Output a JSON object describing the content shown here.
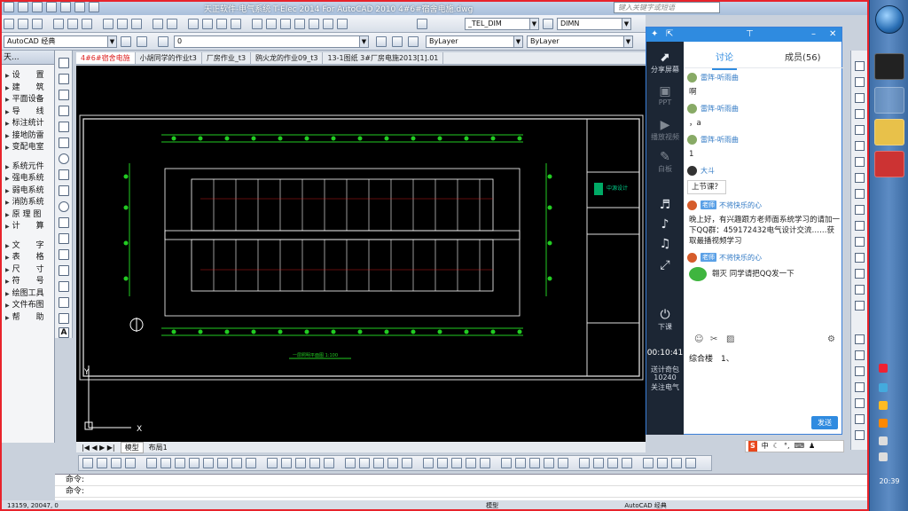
{
  "window": {
    "title": "天正软件-电气系统 T-Elec 2014  For AutoCAD 2010    4#6#宿舍电施.dwg",
    "search_placeholder": "键入关键字或短语"
  },
  "toolbar": {
    "workspace": "AutoCAD 经典",
    "layer_value": "0",
    "text_style": "_TEL_DIM",
    "dim_style": "DIMN",
    "table_style": "Standard",
    "mleader_style": "Standard",
    "color": "ByLayer",
    "linetype": "ByLayer",
    "lineweight": "ByLayer"
  },
  "left_panel": {
    "header": "天...",
    "items": [
      {
        "label": "设　　置"
      },
      {
        "label": "建　　筑"
      },
      {
        "label": "平面设备"
      },
      {
        "label": "导　　线"
      },
      {
        "label": "标注统计"
      },
      {
        "label": "接地防雷"
      },
      {
        "label": "变配电室"
      },
      {
        "label": "系统元件"
      },
      {
        "label": "强电系统"
      },
      {
        "label": "弱电系统"
      },
      {
        "label": "消防系统"
      },
      {
        "label": "原 理 图"
      },
      {
        "label": "计　　算"
      },
      {
        "label": "文　　字"
      },
      {
        "label": "表　　格"
      },
      {
        "label": "尺　　寸"
      },
      {
        "label": "符　　号"
      },
      {
        "label": "绘图工具"
      },
      {
        "label": "文件布图"
      },
      {
        "label": "帮　　助"
      }
    ]
  },
  "doc_tabs": [
    {
      "label": "4#6#宿舍电施",
      "active": true
    },
    {
      "label": "小胡同学的作业t3",
      "active": false
    },
    {
      "label": "厂房作业_t3",
      "active": false
    },
    {
      "label": "鸥火龙的作业09_t3",
      "active": false
    },
    {
      "label": "13-1图纸 3#厂房电施2013[1].01",
      "active": false
    }
  ],
  "drawing": {
    "plan_caption": "一层照明平面图 1:100",
    "logo_text": "中源设计"
  },
  "layout_tabs": [
    "模型",
    "布局1"
  ],
  "command_line": [
    "命令:",
    "命令:"
  ],
  "status_bar": {
    "coords": "13159, 20047, 0",
    "model": "模型",
    "workspace": "AutoCAD 经典"
  },
  "qq_chat": {
    "tabs": {
      "discuss": "讨论",
      "members": "成员(56)"
    },
    "side": {
      "share_screen": "分享屏幕",
      "ppt": "PPT",
      "play_video": "播放视频",
      "whiteboard": "白板",
      "end": "下课",
      "timer": "00:10:41",
      "gift": "送计奇包",
      "count": "10240",
      "follow": "关注电气"
    },
    "messages": [
      {
        "user": "雷阵-听雨曲",
        "text": "啊"
      },
      {
        "user": "雷阵-听雨曲",
        "text": "，a"
      },
      {
        "user": "雷阵-听雨曲",
        "text": "1"
      },
      {
        "user": "大斗",
        "text": "上节课？"
      },
      {
        "user": "不将快乐的心",
        "badge": "老师",
        "text": "晚上好，有兴趣跟方老师面系统学习的请加一下QQ群：459172432电气设计交流……获取最播视频学习"
      },
      {
        "user": "不将快乐的心",
        "badge": "老师",
        "text": "翱灭  同学请把QQ发一下"
      }
    ],
    "input_text": "综合楼　1、",
    "send_label": "发送"
  },
  "taskbar": {
    "time": "20:39"
  },
  "ime": {
    "label": "中"
  }
}
